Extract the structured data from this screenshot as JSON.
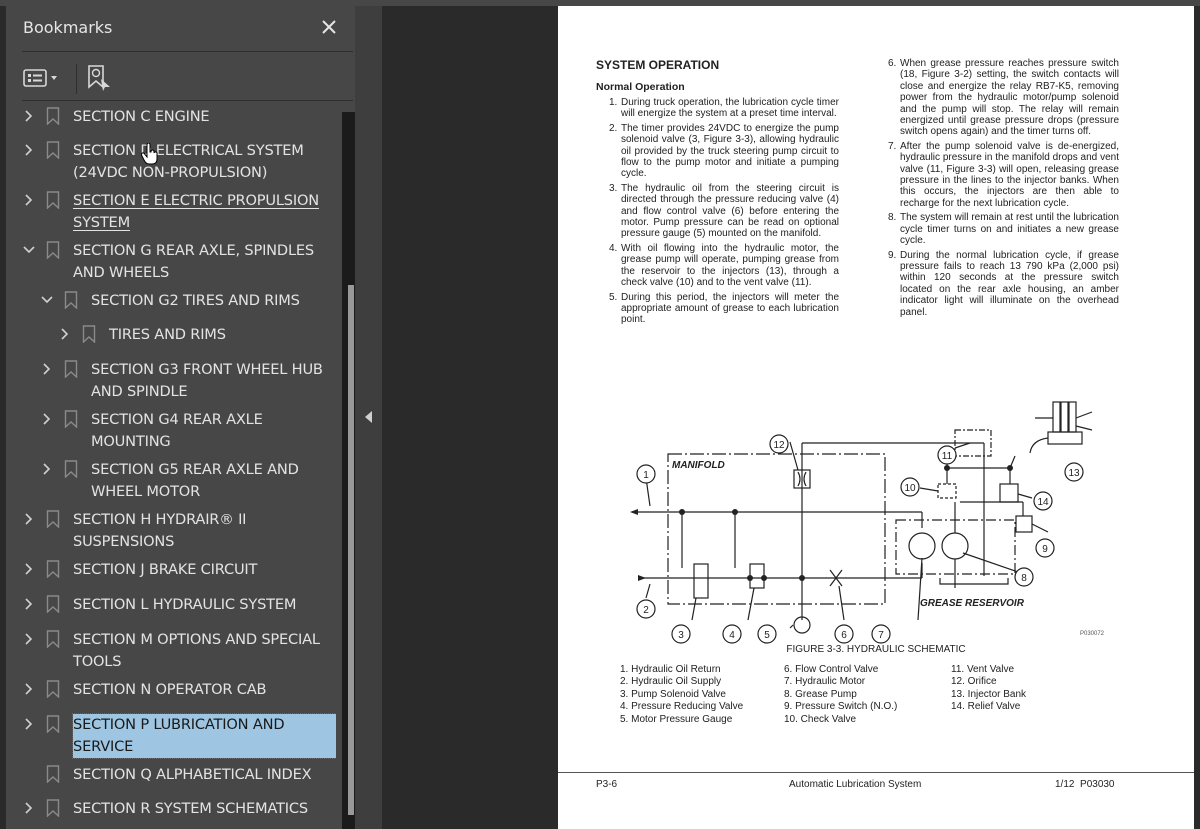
{
  "bookmarks_panel": {
    "title": "Bookmarks",
    "close_icon": "close-icon",
    "toolbar": {
      "options_icon": "list-options-icon",
      "find_icon": "find-bookmark-icon"
    },
    "items": [
      {
        "label": "SECTION C ENGINE",
        "level": 0,
        "expand": "collapsed"
      },
      {
        "label": "SECTION D ELECTRICAL SYSTEM (24VDC NON-PROPULSION)",
        "level": 0,
        "expand": "collapsed"
      },
      {
        "label": "SECTION E ELECTRIC PROPULSION SYSTEM",
        "level": 0,
        "expand": "collapsed",
        "hovered": true
      },
      {
        "label": "SECTION G REAR AXLE, SPINDLES AND WHEELS",
        "level": 0,
        "expand": "expanded"
      },
      {
        "label": "SECTION G2 TIRES AND RIMS",
        "level": 1,
        "expand": "expanded"
      },
      {
        "label": "TIRES AND RIMS",
        "level": 2,
        "expand": "collapsed"
      },
      {
        "label": "SECTION G3 FRONT WHEEL HUB AND SPINDLE",
        "level": 1,
        "expand": "collapsed"
      },
      {
        "label": "SECTION G4 REAR AXLE MOUNTING",
        "level": 1,
        "expand": "collapsed"
      },
      {
        "label": "SECTION G5 REAR AXLE AND WHEEL MOTOR",
        "level": 1,
        "expand": "collapsed"
      },
      {
        "label": "SECTION H HYDRAIR® II SUSPENSIONS",
        "level": 0,
        "expand": "collapsed"
      },
      {
        "label": "SECTION J BRAKE CIRCUIT",
        "level": 0,
        "expand": "collapsed"
      },
      {
        "label": "SECTION L HYDRAULIC SYSTEM",
        "level": 0,
        "expand": "collapsed"
      },
      {
        "label": "SECTION M OPTIONS AND SPECIAL TOOLS",
        "level": 0,
        "expand": "collapsed"
      },
      {
        "label": "SECTION N OPERATOR CAB",
        "level": 0,
        "expand": "collapsed"
      },
      {
        "label": "SECTION P LUBRICATION AND SERVICE",
        "level": 0,
        "expand": "collapsed",
        "selected": true
      },
      {
        "label": "SECTION Q ALPHABETICAL INDEX",
        "level": 0,
        "expand": "none"
      },
      {
        "label": "SECTION R SYSTEM SCHEMATICS",
        "level": 0,
        "expand": "collapsed"
      }
    ]
  },
  "document": {
    "heading": "SYSTEM OPERATION",
    "subheading": "Normal Operation",
    "steps": [
      {
        "num": "1.",
        "text": "During truck operation, the lubrication cycle timer will energize the system at a preset time interval."
      },
      {
        "num": "2.",
        "text": "The timer provides 24VDC to energize the pump solenoid valve (3, Figure 3-3), allowing hydraulic oil provided by the truck steering pump circuit to flow to the pump motor and initiate a pumping cycle."
      },
      {
        "num": "3.",
        "text": "The hydraulic oil from the steering circuit is directed through the pressure reducing valve (4) and flow control valve (6) before entering the motor. Pump pressure can be read on optional pressure gauge (5) mounted on the manifold."
      },
      {
        "num": "4.",
        "text": "With oil flowing into the hydraulic motor, the grease pump will operate, pumping grease from the reservoir to the injectors (13), through a check valve (10) and to the vent valve (11)."
      },
      {
        "num": "5.",
        "text": "During this period, the injectors will meter the appropriate amount of grease to each lubrication point."
      },
      {
        "num": "6.",
        "text": "When grease pressure reaches pressure switch (18, Figure 3-2) setting, the switch contacts will close and energize the relay RB7-K5, removing power from the hydraulic motor/pump solenoid and the pump will stop. The relay will remain energized until grease pressure drops (pressure switch opens again) and the timer turns off."
      },
      {
        "num": "7.",
        "text": "After the pump solenoid valve is de-energized, hydraulic pressure in the manifold drops and vent valve (11, Figure 3-3) will open, releasing grease pressure in the lines to the injector banks. When this occurs, the injectors are then able to recharge for the next lubrication cycle."
      },
      {
        "num": "8.",
        "text": "The system will remain at rest until the lubrication cycle timer turns on and initiates a new grease cycle."
      },
      {
        "num": "9.",
        "text": "During the normal lubrication cycle, if grease pressure fails to reach 13 790 kPa (2,000 psi) within 120 seconds at the pressure switch located on the rear axle housing, an amber indicator light will illuminate on the overhead panel."
      }
    ],
    "figure": {
      "manifold_label": "MANIFOLD",
      "reservoir_label": "GREASE RESERVOIR",
      "callouts": [
        "1",
        "2",
        "3",
        "4",
        "5",
        "6",
        "7",
        "8",
        "9",
        "10",
        "11",
        "12",
        "13",
        "14"
      ],
      "code": "P030072",
      "caption": "FIGURE 3-3. HYDRAULIC SCHEMATIC",
      "legend": [
        [
          "1. Hydraulic Oil Return",
          "2. Hydraulic Oil Supply",
          "3. Pump Solenoid Valve",
          "4. Pressure Reducing Valve",
          "5. Motor Pressure Gauge"
        ],
        [
          "6. Flow Control Valve",
          "7. Hydraulic Motor",
          "8. Grease Pump",
          "9. Pressure Switch (N.O.)",
          "10. Check Valve"
        ],
        [
          "11. Vent Valve",
          "12. Orifice",
          "13. Injector Bank",
          "14. Relief Valve"
        ]
      ]
    },
    "footer": {
      "page": "P3-6",
      "title": "Automatic Lubrication System",
      "code": "1/12  P03030"
    }
  }
}
